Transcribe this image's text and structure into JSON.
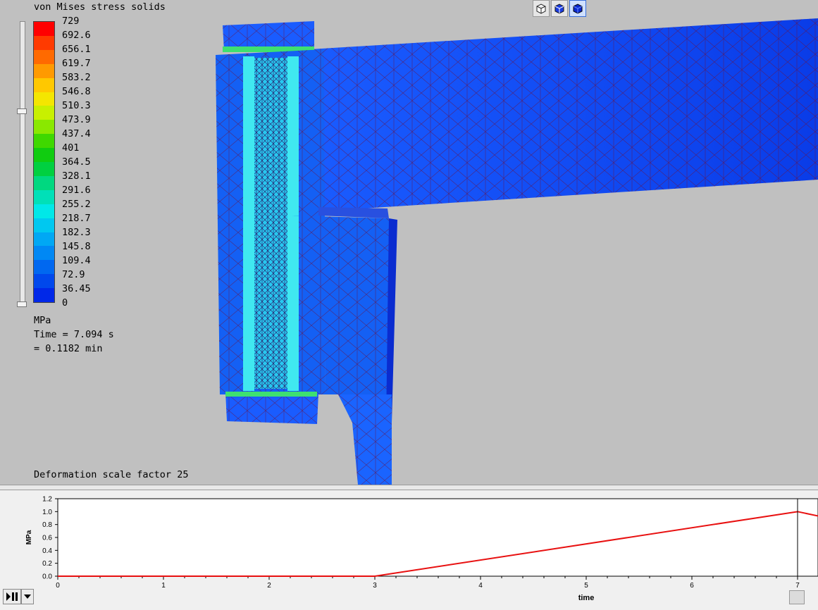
{
  "legend": {
    "title": "von Mises stress solids",
    "ticks": [
      "729",
      "692.6",
      "656.1",
      "619.7",
      "583.2",
      "546.8",
      "510.3",
      "473.9",
      "437.4",
      "401",
      "364.5",
      "328.1",
      "291.6",
      "255.2",
      "218.7",
      "182.3",
      "145.8",
      "109.4",
      "72.9",
      "36.45",
      "0"
    ],
    "unit": "MPa",
    "colors": [
      "#ff0000",
      "#ff3a00",
      "#ff6a00",
      "#ff9a00",
      "#ffc800",
      "#f4e600",
      "#c8f000",
      "#8ae800",
      "#3fd800",
      "#10cc10",
      "#00d040",
      "#00d880",
      "#00e0b8",
      "#00e8e8",
      "#00c8f0",
      "#00a8f4",
      "#0088f4",
      "#0068f0",
      "#0048ec",
      "#0028e8"
    ]
  },
  "info": {
    "time_line": "Time = 7.094 s",
    "min_line": "= 0.1182 min",
    "deformation": "Deformation scale factor 25"
  },
  "view_buttons": [
    "wireframe-cube-icon",
    "solid-cube-icon",
    "shaded-cube-icon"
  ],
  "chart_data": {
    "type": "line",
    "xlabel": "time",
    "ylabel": "MPa",
    "xlim": [
      0,
      7.2
    ],
    "ylim": [
      0,
      1.2
    ],
    "x_ticks": [
      "0",
      "1",
      "2",
      "3",
      "4",
      "5",
      "6",
      "7"
    ],
    "y_ticks": [
      "0.0",
      "0.2",
      "0.4",
      "0.6",
      "0.8",
      "1.0",
      "1.2"
    ],
    "series": [
      {
        "color": "#e81010",
        "x": [
          0,
          3,
          7,
          7.2
        ],
        "y": [
          0,
          0,
          1.0,
          0.93
        ]
      }
    ],
    "cursor_x": 7.0
  },
  "controls": {
    "play_icon": "play-pause-icon",
    "dropdown_icon": "chevron-down-icon"
  }
}
